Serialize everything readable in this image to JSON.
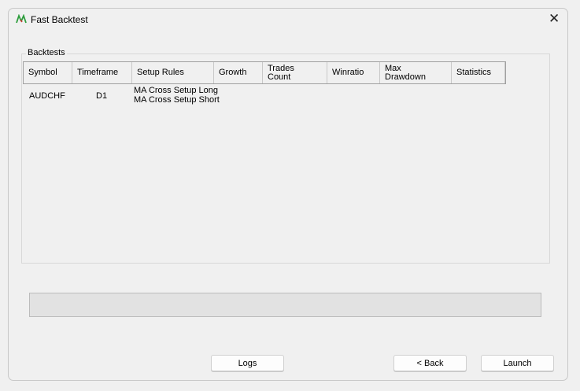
{
  "window": {
    "title": "Fast Backtest",
    "close_icon": "close-icon"
  },
  "group": {
    "label": "Backtests"
  },
  "table": {
    "headers": [
      "Symbol",
      "Timeframe",
      "Setup Rules",
      "Growth",
      "Trades\nCount",
      "Winratio",
      "Max\nDrawdown",
      "Statistics"
    ],
    "rows": [
      {
        "symbol": "AUDCHF",
        "timeframe": "D1",
        "setup_rules": [
          "MA Cross Setup Long",
          "MA Cross Setup Short"
        ],
        "growth": "",
        "trades_count": "",
        "winratio": "",
        "max_drawdown": "",
        "statistics": ""
      }
    ]
  },
  "progress": {
    "value": 0
  },
  "buttons": {
    "logs": "Logs",
    "back": "< Back",
    "launch": "Launch"
  },
  "colors": {
    "logo_green": "#2e9e3e",
    "logo_red": "#d03030"
  }
}
